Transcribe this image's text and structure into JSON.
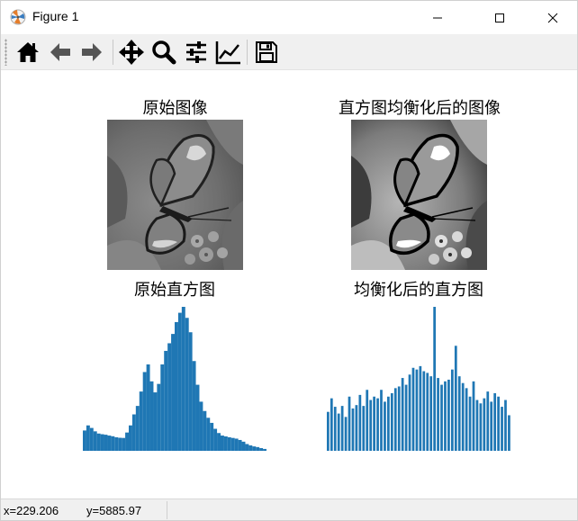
{
  "window": {
    "title": "Figure 1",
    "icon": "matplotlib-logo-icon",
    "controls": [
      "minimize-icon",
      "maximize-icon",
      "close-icon"
    ]
  },
  "toolbar": {
    "buttons": [
      {
        "name": "home-button",
        "icon": "home-icon"
      },
      {
        "name": "back-button",
        "icon": "arrow-left-icon"
      },
      {
        "name": "forward-button",
        "icon": "arrow-right-icon"
      },
      {
        "name": "pan-button",
        "icon": "move-arrows-icon"
      },
      {
        "name": "zoom-button",
        "icon": "magnifier-icon"
      },
      {
        "name": "configure-subplots-button",
        "icon": "sliders-icon"
      },
      {
        "name": "edit-axes-button",
        "icon": "line-chart-icon"
      },
      {
        "name": "save-button",
        "icon": "floppy-disk-icon"
      }
    ]
  },
  "figure": {
    "subplots": [
      {
        "title": "原始图像",
        "kind": "image",
        "colormap": "gray"
      },
      {
        "title": "直方图均衡化后的图像",
        "kind": "image",
        "colormap": "gray"
      },
      {
        "title": "原始直方图",
        "kind": "histogram",
        "color": "#1f77b4"
      },
      {
        "title": "均衡化后的直方图",
        "kind": "histogram",
        "color": "#1f77b4"
      }
    ]
  },
  "chart_data": [
    {
      "type": "bar",
      "title": "原始直方图",
      "axis_visible": false,
      "color": "#1f77b4",
      "x": [
        0,
        5,
        10,
        15,
        20,
        25,
        30,
        35,
        40,
        45,
        50,
        55,
        60,
        65,
        70,
        75,
        80,
        85,
        90,
        95,
        100,
        105,
        110,
        115,
        120,
        125,
        130,
        135,
        140,
        145,
        150,
        155,
        160,
        165,
        170,
        175,
        180,
        185,
        190,
        195,
        200,
        205,
        210,
        215,
        220,
        225,
        230,
        235,
        240,
        245,
        250,
        255
      ],
      "values": [
        1200,
        1500,
        1350,
        1150,
        1020,
        980,
        950,
        900,
        860,
        800,
        770,
        760,
        1080,
        1500,
        2150,
        2650,
        3500,
        4650,
        5100,
        4100,
        3450,
        3950,
        5100,
        5900,
        6350,
        6900,
        7600,
        8150,
        8500,
        7850,
        7000,
        5300,
        3900,
        2900,
        2350,
        1950,
        1650,
        1300,
        1050,
        900,
        850,
        800,
        760,
        720,
        640,
        540,
        400,
        320,
        260,
        220,
        160,
        110
      ]
    },
    {
      "type": "bar",
      "title": "均衡化后的直方图",
      "axis_visible": false,
      "color": "#1f77b4",
      "x": [
        0,
        5,
        10,
        15,
        20,
        25,
        30,
        35,
        40,
        45,
        50,
        55,
        60,
        65,
        70,
        75,
        80,
        85,
        90,
        95,
        100,
        105,
        110,
        115,
        120,
        125,
        130,
        135,
        140,
        145,
        150,
        155,
        160,
        165,
        170,
        175,
        180,
        185,
        190,
        195,
        200,
        205,
        210,
        215,
        220,
        225,
        230,
        235,
        240,
        245,
        250,
        255
      ],
      "values": [
        2300,
        3100,
        2600,
        2200,
        2650,
        2000,
        3200,
        2500,
        2700,
        3300,
        2650,
        3600,
        3000,
        3200,
        3100,
        3600,
        2900,
        3200,
        3400,
        3700,
        3800,
        4300,
        3900,
        4500,
        4900,
        4800,
        5000,
        4700,
        4600,
        4400,
        8500,
        4300,
        3900,
        4100,
        4200,
        4800,
        6200,
        4400,
        4000,
        3700,
        3200,
        4100,
        3000,
        2800,
        3100,
        3500,
        2900,
        3400,
        3200,
        2600,
        3000,
        2100
      ]
    }
  ],
  "status": {
    "x_readout": "x=229.206",
    "y_readout": "y=5885.97"
  }
}
